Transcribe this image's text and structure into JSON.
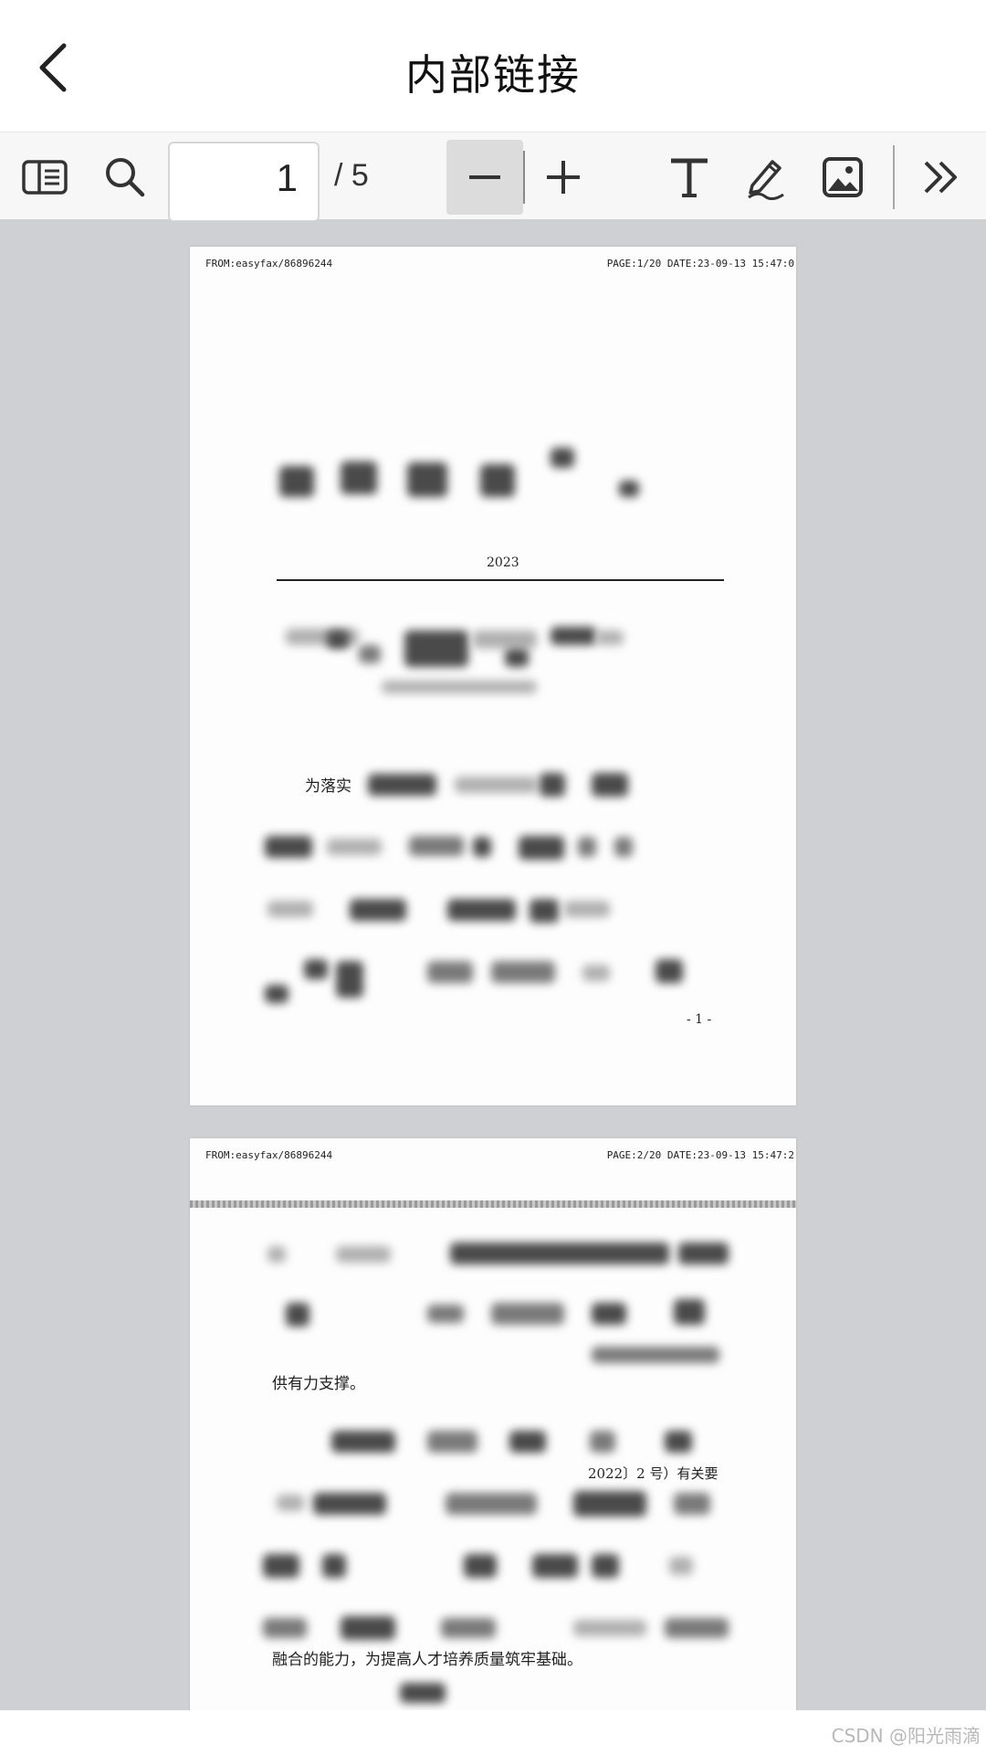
{
  "header": {
    "title": "内部链接"
  },
  "toolbar": {
    "page_input_value": "1",
    "page_total": "/ 5",
    "icons": [
      "sidebar-icon",
      "search-icon",
      "zoom-out-icon",
      "zoom-in-icon",
      "text-tool-icon",
      "pen-icon",
      "image-icon",
      "more-icon"
    ]
  },
  "pages": [
    {
      "fax_from": "FROM:easyfax/86896244",
      "fax_page": "PAGE:1/20  DATE:23-09-13 15:47:0",
      "year": "2023",
      "para_start": "为落实",
      "page_number": "- 1 -"
    },
    {
      "fax_from": "FROM:easyfax/86896244",
      "fax_page": "PAGE:2/20  DATE:23-09-13 15:47:2",
      "line1": "供有力支撑。",
      "line2": "2022〕2 号）有关要",
      "line3": "融合的能力，为提高人才培养质量筑牢基础。"
    }
  ],
  "watermark": "CSDN @阳光雨滴"
}
